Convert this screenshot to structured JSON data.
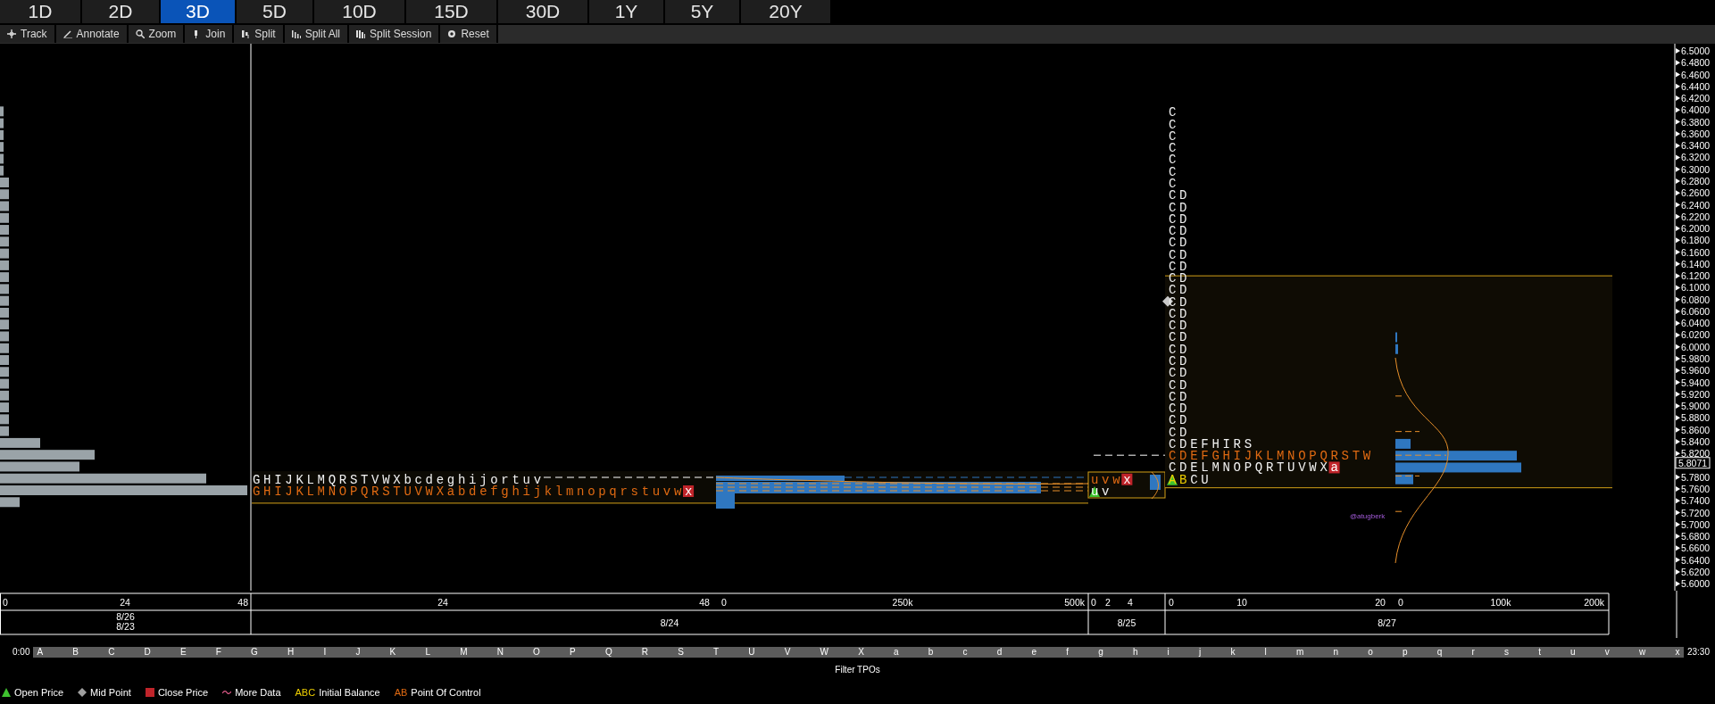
{
  "range_tabs": [
    {
      "label": "1D",
      "selected": false
    },
    {
      "label": "2D",
      "selected": false
    },
    {
      "label": "3D",
      "selected": true
    },
    {
      "label": "5D",
      "selected": false
    },
    {
      "label": "10D",
      "selected": false
    },
    {
      "label": "15D",
      "selected": false
    },
    {
      "label": "30D",
      "selected": false
    },
    {
      "label": "1Y",
      "selected": false
    },
    {
      "label": "5Y",
      "selected": false
    },
    {
      "label": "20Y",
      "selected": false
    }
  ],
  "toolbar": [
    {
      "label": "Track",
      "kind": "track"
    },
    {
      "label": "Annotate",
      "kind": "annotate"
    },
    {
      "label": "Zoom",
      "kind": "zoom"
    },
    {
      "label": "Join",
      "kind": "join"
    },
    {
      "label": "Split",
      "kind": "split"
    },
    {
      "label": "Split All",
      "kind": "split_all"
    },
    {
      "label": "Split Session",
      "kind": "split_session"
    },
    {
      "label": "Reset",
      "kind": "reset"
    }
  ],
  "price_axis": {
    "ticks": [
      "6.5000",
      "6.4800",
      "6.4600",
      "6.4400",
      "6.4200",
      "6.4000",
      "6.3800",
      "6.3600",
      "6.3400",
      "6.3200",
      "6.3000",
      "6.2800",
      "6.2600",
      "6.2400",
      "6.2200",
      "6.2000",
      "6.1800",
      "6.1600",
      "6.1400",
      "6.1200",
      "6.1000",
      "6.0800",
      "6.0600",
      "6.0400",
      "6.0200",
      "6.0000",
      "5.9800",
      "5.9600",
      "5.9400",
      "5.9200",
      "5.9000",
      "5.8800",
      "5.8600",
      "5.8400",
      "5.8200",
      "5.7800",
      "5.7600",
      "5.7400",
      "5.7200",
      "5.7000",
      "5.6800",
      "5.6600",
      "5.6400",
      "5.6200",
      "5.6000"
    ],
    "last_price": "5.8071"
  },
  "sessions": [
    {
      "rows": [
        {
          "mid": false,
          "segments": [
            {
              "kind": "plain",
              "text": "GHIJKLMQRSTVWXbcdeghijortuv"
            }
          ]
        },
        {
          "mid": false,
          "segments": [
            {
              "kind": "poc",
              "text": "GHIJKLMNOPQRSTUVWXabdefghijklmnopqrstuvw"
            },
            {
              "kind": "close",
              "text": "x"
            }
          ]
        }
      ]
    },
    {
      "rows": [
        {
          "mid": false,
          "segments": [
            {
              "kind": "poc",
              "text": "uvw"
            },
            {
              "kind": "close",
              "text": "x"
            }
          ]
        },
        {
          "mid": false,
          "segments": [
            {
              "kind": "open",
              "ib": false,
              "text": "u"
            },
            {
              "kind": "plain",
              "text": "v"
            }
          ]
        }
      ]
    },
    {
      "rows": [
        {
          "mid": false,
          "segments": [
            {
              "kind": "plain",
              "text": "C"
            }
          ]
        },
        {
          "mid": false,
          "segments": [
            {
              "kind": "plain",
              "text": "C"
            }
          ]
        },
        {
          "mid": false,
          "segments": [
            {
              "kind": "plain",
              "text": "C"
            }
          ]
        },
        {
          "mid": false,
          "segments": [
            {
              "kind": "plain",
              "text": "C"
            }
          ]
        },
        {
          "mid": false,
          "segments": [
            {
              "kind": "plain",
              "text": "C"
            }
          ]
        },
        {
          "mid": false,
          "segments": [
            {
              "kind": "plain",
              "text": "C"
            }
          ]
        },
        {
          "mid": false,
          "segments": [
            {
              "kind": "plain",
              "text": "C"
            }
          ]
        },
        {
          "mid": false,
          "segments": [
            {
              "kind": "plain",
              "text": "CD"
            }
          ]
        },
        {
          "mid": false,
          "segments": [
            {
              "kind": "plain",
              "text": "CD"
            }
          ]
        },
        {
          "mid": false,
          "segments": [
            {
              "kind": "plain",
              "text": "CD"
            }
          ]
        },
        {
          "mid": false,
          "segments": [
            {
              "kind": "plain",
              "text": "CD"
            }
          ]
        },
        {
          "mid": false,
          "segments": [
            {
              "kind": "plain",
              "text": "CD"
            }
          ]
        },
        {
          "mid": false,
          "segments": [
            {
              "kind": "plain",
              "text": "CD"
            }
          ]
        },
        {
          "mid": false,
          "segments": [
            {
              "kind": "plain",
              "text": "CD"
            }
          ]
        },
        {
          "mid": false,
          "segments": [
            {
              "kind": "plain",
              "text": "CD"
            }
          ]
        },
        {
          "mid": false,
          "segments": [
            {
              "kind": "plain",
              "text": "CD"
            }
          ]
        },
        {
          "mid": true,
          "segments": [
            {
              "kind": "plain",
              "text": "CD"
            }
          ]
        },
        {
          "mid": false,
          "segments": [
            {
              "kind": "plain",
              "text": "CD"
            }
          ]
        },
        {
          "mid": false,
          "segments": [
            {
              "kind": "plain",
              "text": "CD"
            }
          ]
        },
        {
          "mid": false,
          "segments": [
            {
              "kind": "plain",
              "text": "CD"
            }
          ]
        },
        {
          "mid": false,
          "segments": [
            {
              "kind": "plain",
              "text": "CD"
            }
          ]
        },
        {
          "mid": false,
          "segments": [
            {
              "kind": "plain",
              "text": "CD"
            }
          ]
        },
        {
          "mid": false,
          "segments": [
            {
              "kind": "plain",
              "text": "CD"
            }
          ]
        },
        {
          "mid": false,
          "segments": [
            {
              "kind": "plain",
              "text": "CD"
            }
          ]
        },
        {
          "mid": false,
          "segments": [
            {
              "kind": "plain",
              "text": "CD"
            }
          ]
        },
        {
          "mid": false,
          "segments": [
            {
              "kind": "plain",
              "text": "CD"
            }
          ]
        },
        {
          "mid": false,
          "segments": [
            {
              "kind": "plain",
              "text": "CD"
            }
          ]
        },
        {
          "mid": false,
          "segments": [
            {
              "kind": "plain",
              "text": "CD"
            }
          ]
        },
        {
          "mid": false,
          "segments": [
            {
              "kind": "plain",
              "text": "CDEFHIRS"
            }
          ]
        },
        {
          "mid": false,
          "segments": [
            {
              "kind": "poc",
              "text": "CDEFGHIJKLMNOPQRSTW"
            }
          ]
        },
        {
          "mid": false,
          "segments": [
            {
              "kind": "plain",
              "text": "CDELMNOPQRTUVWX"
            },
            {
              "kind": "close",
              "text": "a"
            }
          ]
        },
        {
          "mid": false,
          "segments": [
            {
              "kind": "open",
              "ib": true,
              "text": "A"
            },
            {
              "kind": "ib",
              "text": "B"
            },
            {
              "kind": "plain",
              "text": "CU"
            }
          ]
        }
      ]
    }
  ],
  "annotation": "@atugberk",
  "x_axes": [
    {
      "ticks": [
        "0",
        "24",
        "48"
      ],
      "dates": [
        "8/26",
        "8/23"
      ]
    },
    {
      "ticks": [
        "24",
        "48",
        "0",
        "250k",
        "500k"
      ],
      "dates": [
        "8/24"
      ]
    },
    {
      "ticks": [
        "0",
        "2",
        "4"
      ],
      "dates": [
        "8/25"
      ]
    },
    {
      "ticks": [
        "0",
        "10",
        "20",
        "0",
        "100k",
        "200k"
      ],
      "dates": [
        "8/27"
      ]
    }
  ],
  "filter_tpos": {
    "start": "0:00",
    "end": "23:30",
    "caption": "Filter TPOs",
    "letters": [
      "A",
      "B",
      "C",
      "D",
      "E",
      "F",
      "G",
      "H",
      "I",
      "J",
      "K",
      "L",
      "M",
      "N",
      "O",
      "P",
      "Q",
      "R",
      "S",
      "T",
      "U",
      "V",
      "W",
      "X",
      "a",
      "b",
      "c",
      "d",
      "e",
      "f",
      "g",
      "h",
      "i",
      "j",
      "k",
      "l",
      "m",
      "n",
      "o",
      "p",
      "q",
      "r",
      "s",
      "t",
      "u",
      "v",
      "w",
      "x"
    ]
  },
  "legend": [
    {
      "kind": "open",
      "label": "Open Price"
    },
    {
      "kind": "mid",
      "label": "Mid Point"
    },
    {
      "kind": "close",
      "label": "Close Price"
    },
    {
      "kind": "more",
      "label": "More Data"
    },
    {
      "kind": "ib",
      "sample": "ABC",
      "label": "Initial Balance"
    },
    {
      "kind": "poc",
      "sample": "AB",
      "label": "Point Of Control"
    }
  ]
}
